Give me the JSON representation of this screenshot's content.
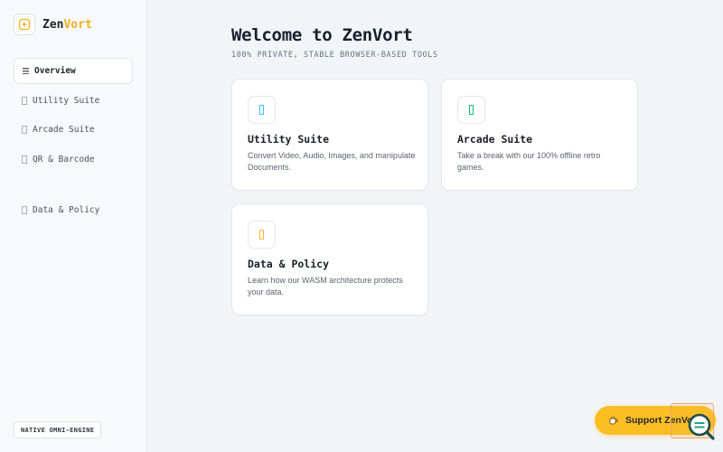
{
  "brand": {
    "name_prefix": "Zen",
    "name_accent": "Vort",
    "logo_icon": "frame-plus-icon"
  },
  "sidebar": {
    "items": [
      {
        "label": "Overview",
        "icon": "list-icon",
        "active": true
      },
      {
        "label": "Utility Suite",
        "icon": "box-icon",
        "active": false
      },
      {
        "label": "Arcade Suite",
        "icon": "box-icon",
        "active": false
      },
      {
        "label": "QR & Barcode",
        "icon": "box-icon",
        "active": false
      }
    ],
    "footer_items": [
      {
        "label": "Data & Policy",
        "icon": "box-icon",
        "active": false
      }
    ],
    "engine_badge": "NATIVE OMNI-ENGINE"
  },
  "main": {
    "title": "Welcome to ZenVort",
    "subtitle": "100% PRIVATE, STABLE BROWSER-BASED TOOLS",
    "cards": [
      {
        "title": "Utility Suite",
        "description": "Convert Video, Audio, Images, and manipulate Documents.",
        "icon": "box-icon",
        "icon_color": "#38bdf8"
      },
      {
        "title": "Arcade Suite",
        "description": "Take a break with our 100% offline retro games.",
        "icon": "box-icon",
        "icon_color": "#10b981"
      },
      {
        "title": "Data & Policy",
        "description": "Learn how our WASM architecture protects your data.",
        "icon": "box-icon",
        "icon_color": "#f5b82e"
      }
    ]
  },
  "support": {
    "label": "Support ZenVort",
    "icon": "coffee-icon",
    "color": "#fbbf24"
  },
  "colors": {
    "accent": "#f2b01e",
    "background": "#f2f5f8",
    "sidebar_bg": "#f7f9fb"
  }
}
